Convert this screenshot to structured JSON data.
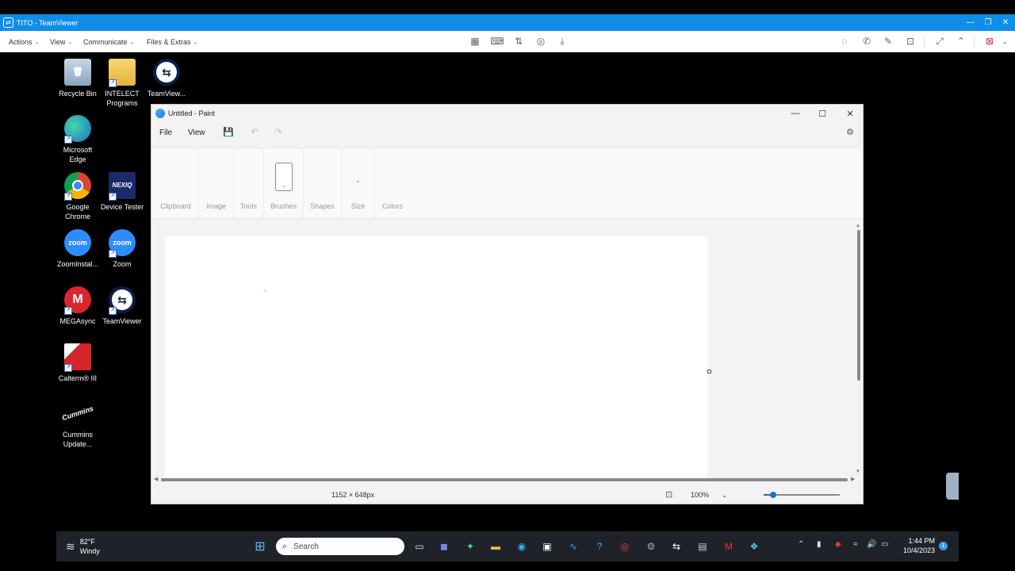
{
  "teamviewer": {
    "title": "TITO - TeamViewer",
    "logo_icon": "teamviewer-logo-icon",
    "menus": [
      "Actions",
      "View",
      "Communicate",
      "Files & Extras"
    ],
    "toolbar_icons": [
      "dashboard-icon",
      "remote-input-icon",
      "file-transfer-icon",
      "recording-icon",
      "download-icon",
      "chat-icon",
      "call-icon",
      "whiteboard-icon",
      "screenshot-icon",
      "fullscreen-icon",
      "collapse-icon",
      "end-session-icon"
    ],
    "accent_color": "#0e8ee9"
  },
  "desktop": {
    "icons": [
      {
        "label": "Recycle Bin",
        "icon": "recycle-bin-icon"
      },
      {
        "label": "INTELECT Programs",
        "icon": "folder-icon"
      },
      {
        "label": "TeamView...",
        "icon": "teamviewer-icon"
      },
      {
        "label": "Microsoft Edge",
        "icon": "edge-icon"
      },
      {
        "label": "Google Chrome",
        "icon": "chrome-icon"
      },
      {
        "label": "Device Tester",
        "icon": "nexiq-icon",
        "glyph": "NEXIQ"
      },
      {
        "label": "ZoomInstal...",
        "icon": "zoom-installer-icon",
        "glyph": "zoom"
      },
      {
        "label": "Zoom",
        "icon": "zoom-icon",
        "glyph": "zoom"
      },
      {
        "label": "MEGAsync",
        "icon": "mega-icon",
        "glyph": "M"
      },
      {
        "label": "TeamViewer",
        "icon": "teamviewer-icon"
      },
      {
        "label": "Calterm® III",
        "icon": "calterm-icon"
      },
      {
        "label": "Cummins Update...",
        "icon": "cummins-icon",
        "glyph": "Cummins"
      }
    ]
  },
  "paint": {
    "title": "Untitled - Paint",
    "menu": {
      "file": "File",
      "view": "View"
    },
    "ribbon_groups": [
      "Clipboard",
      "Image",
      "Tools",
      "Brushes",
      "Shapes",
      "Size",
      "Colors"
    ],
    "status": {
      "dimensions": "1152 × 648px",
      "zoom": "100%"
    },
    "zoom_slider_value": 0.12
  },
  "taskbar": {
    "weather": {
      "temp": "82°F",
      "desc": "Windy"
    },
    "search_placeholder": "Search",
    "apps": [
      "start-icon",
      "task-view-icon",
      "teams-chat-icon",
      "browser-icon",
      "file-explorer-icon",
      "edge-icon",
      "store-icon",
      "monitor-icon",
      "help-icon",
      "chrome-icon",
      "settings-icon",
      "teamviewer-icon",
      "calterm-icon",
      "mega-icon",
      "paint-icon"
    ],
    "clock": {
      "time": "1:44 PM",
      "date": "10/4/2023"
    },
    "notification_count": "1"
  }
}
